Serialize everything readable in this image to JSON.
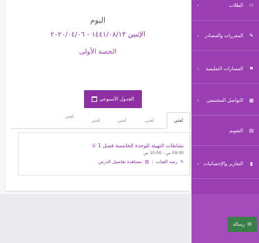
{
  "schedule": {
    "day": "اليوم",
    "date": "الإثنين ١٤٤١/٠٨/١٣ - ٢٠٢٠/٠٤/٠٦",
    "period": "الحصة الأولى",
    "weekly_button": "الجدول الأسبوعي"
  },
  "tabs": [
    "لغتي",
    "لغتي",
    "لغتي",
    "لغتي",
    "لغتي"
  ],
  "lesson": {
    "title": "نشاطات التهيئة للوحدة الخامسة فصل 1 ①",
    "time": "09:00 ص - 10:00 ص",
    "attendance": "رصد الغياب",
    "details": "مشاهدة تفاصيل الدرس"
  },
  "sidebar": {
    "items": [
      {
        "label": "الطلاب",
        "icon": "students-icon"
      },
      {
        "label": "المقررات والمصادر",
        "icon": "courses-icon"
      },
      {
        "label": "المسارات التعليمية",
        "icon": "paths-icon"
      },
      {
        "label": "التواصل المجتمعي",
        "icon": "community-icon"
      },
      {
        "label": "التقويم",
        "icon": "calendar-icon"
      },
      {
        "label": "التقارير والإحصائيات",
        "icon": "reports-icon"
      }
    ]
  },
  "message_button": "رسالة",
  "colors": {
    "accent": "#9a3fb2",
    "button": "#8e2fa4",
    "message": "#3a7f49"
  }
}
